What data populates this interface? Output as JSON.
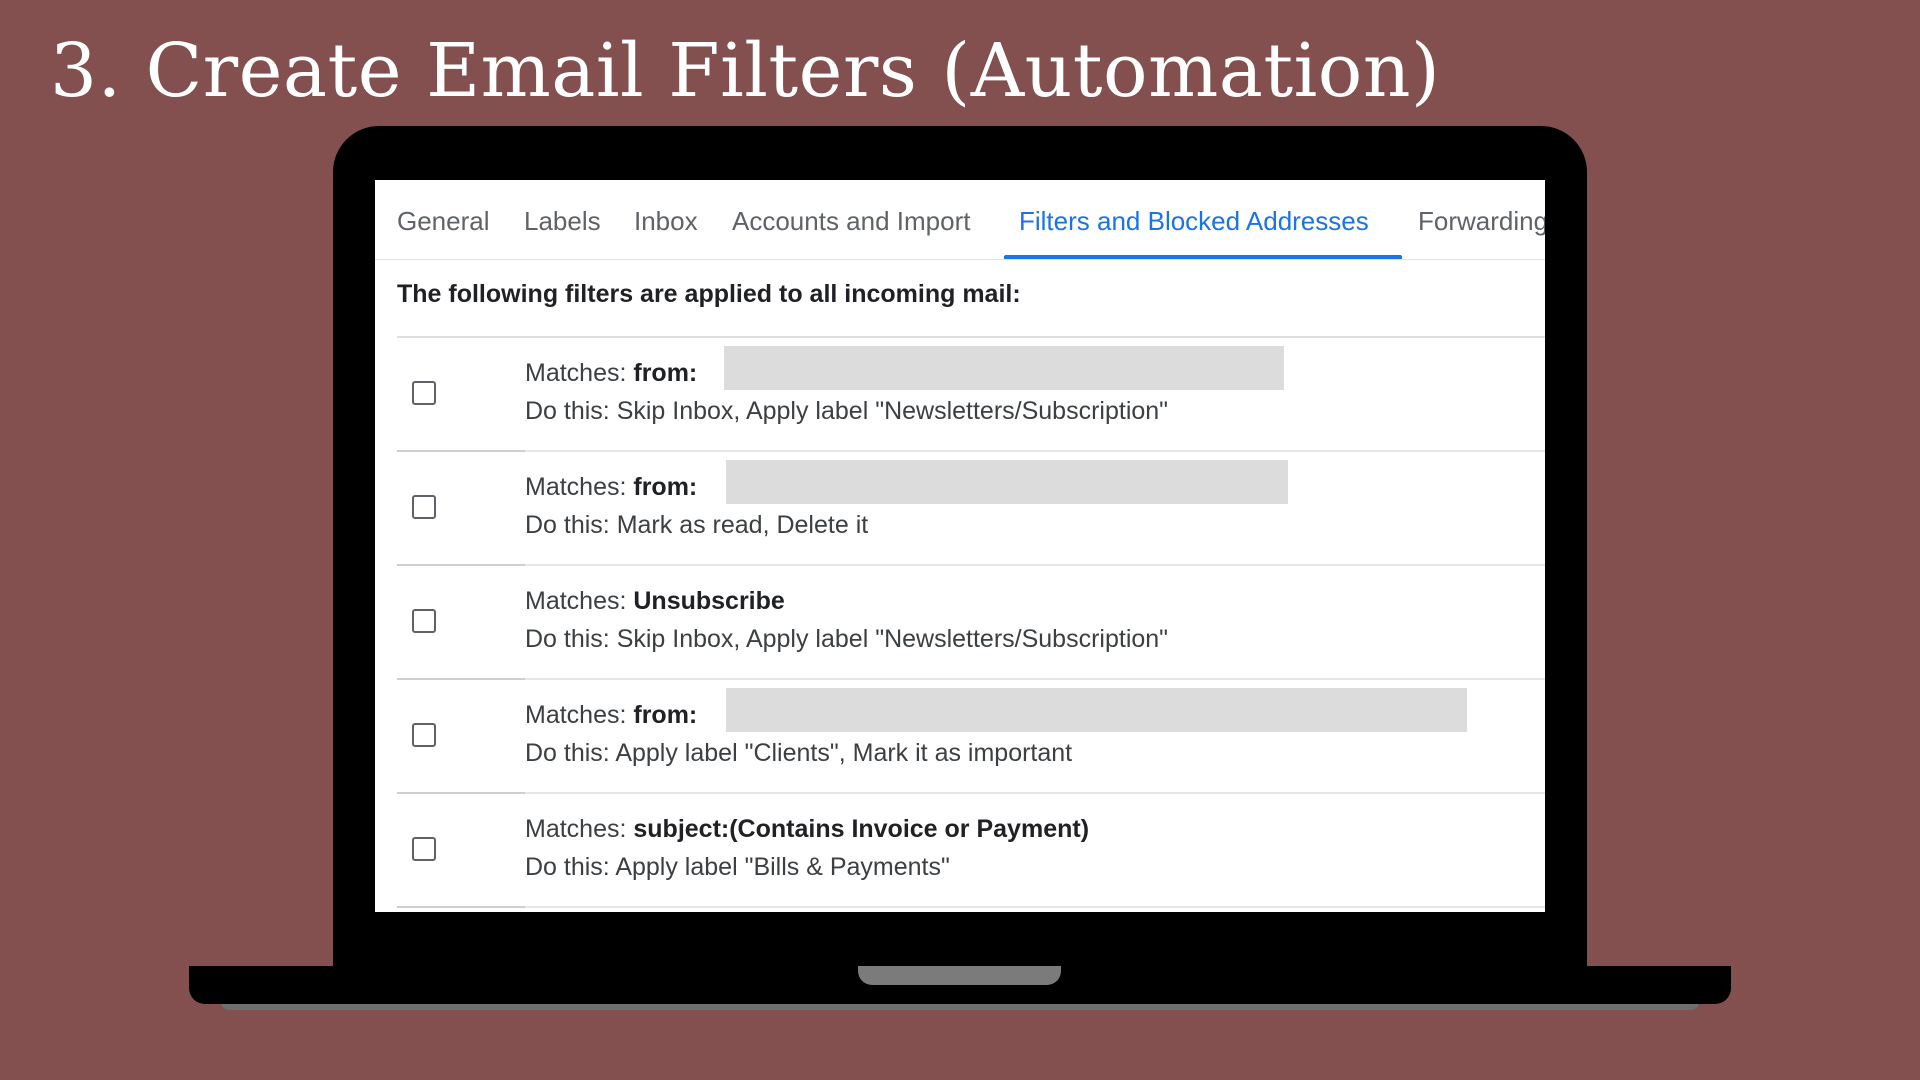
{
  "slide": {
    "title": "3. Create Email Filters (Automation)"
  },
  "settings": {
    "tabs": [
      {
        "label": "General",
        "active": false
      },
      {
        "label": "Labels",
        "active": false
      },
      {
        "label": "Inbox",
        "active": false
      },
      {
        "label": "Accounts and Import",
        "active": false
      },
      {
        "label": "Filters and Blocked Addresses",
        "active": true
      },
      {
        "label": "Forwarding",
        "active": false
      }
    ],
    "accent_color": "#1a73e8",
    "intro": "The following filters are applied to all incoming mail:",
    "filters": [
      {
        "matches_prefix": "Matches: ",
        "criteria": "from:",
        "action": "Do this: Skip Inbox, Apply label \"Newsletters/Subscription\"",
        "redacted": true,
        "checked": false
      },
      {
        "matches_prefix": "Matches: ",
        "criteria": "from:",
        "action": "Do this: Mark as read, Delete it",
        "redacted": true,
        "checked": false
      },
      {
        "matches_prefix": "Matches: ",
        "criteria": "Unsubscribe",
        "action": "Do this: Skip Inbox, Apply label \"Newsletters/Subscription\"",
        "redacted": false,
        "checked": false
      },
      {
        "matches_prefix": "Matches: ",
        "criteria": "from:",
        "action": "Do this: Apply label \"Clients\", Mark it as important",
        "redacted": true,
        "checked": false
      },
      {
        "matches_prefix": "Matches: ",
        "criteria": "subject:(Contains Invoice or Payment)",
        "action": "Do this: Apply label \"Bills & Payments\"",
        "redacted": false,
        "checked": false
      }
    ]
  }
}
